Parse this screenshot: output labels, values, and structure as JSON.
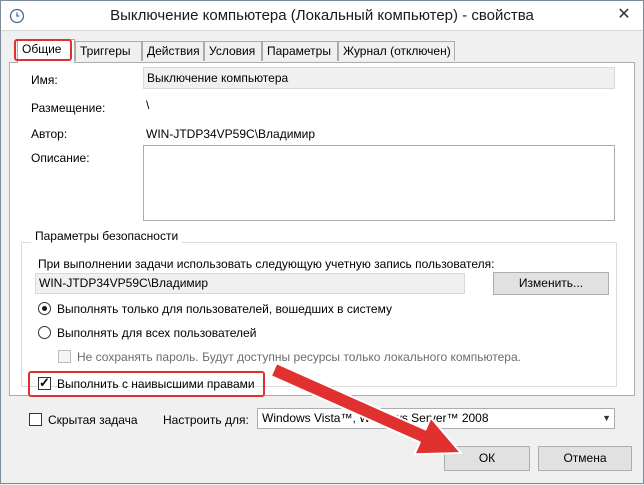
{
  "window": {
    "title": "Выключение компьютера (Локальный компьютер) - свойства",
    "close_glyph": "✕"
  },
  "tabs": [
    {
      "label": "Общие",
      "active": true
    },
    {
      "label": "Триггеры"
    },
    {
      "label": "Действия"
    },
    {
      "label": "Условия"
    },
    {
      "label": "Параметры"
    },
    {
      "label": "Журнал (отключен)"
    }
  ],
  "general": {
    "name_label": "Имя:",
    "name_value": "Выключение компьютера",
    "location_label": "Размещение:",
    "location_value": "\\",
    "author_label": "Автор:",
    "author_value": "WIN-JTDP34VP59C\\Владимир",
    "description_label": "Описание:",
    "description_value": ""
  },
  "security": {
    "group_title": "Параметры безопасности",
    "account_prompt": "При выполнении задачи использовать следующую учетную запись пользователя:",
    "account_value": "WIN-JTDP34VP59C\\Владимир",
    "change_button": "Изменить...",
    "radio_logged_on": "Выполнять только для пользователей, вошедших в систему",
    "radio_all_users": "Выполнять для всех пользователей",
    "no_store_password": "Не сохранять пароль. Будут доступны ресурсы только локального компьютера.",
    "highest_privileges": "Выполнить с наивысшими правами",
    "selected_radio": "logged_on",
    "highest_privileges_checked": true
  },
  "bottom": {
    "hidden_task": "Скрытая задача",
    "configure_for_label": "Настроить для:",
    "configure_for_value": "Windows Vista™, Windows Server™ 2008"
  },
  "buttons": {
    "ok": "ОК",
    "cancel": "Отмена"
  },
  "icons": {
    "title": "clock-icon",
    "close": "close-icon",
    "dropdown": "chevron-down-icon",
    "annotation": "red-arrow"
  },
  "colors": {
    "annotation_red": "#e03030"
  }
}
